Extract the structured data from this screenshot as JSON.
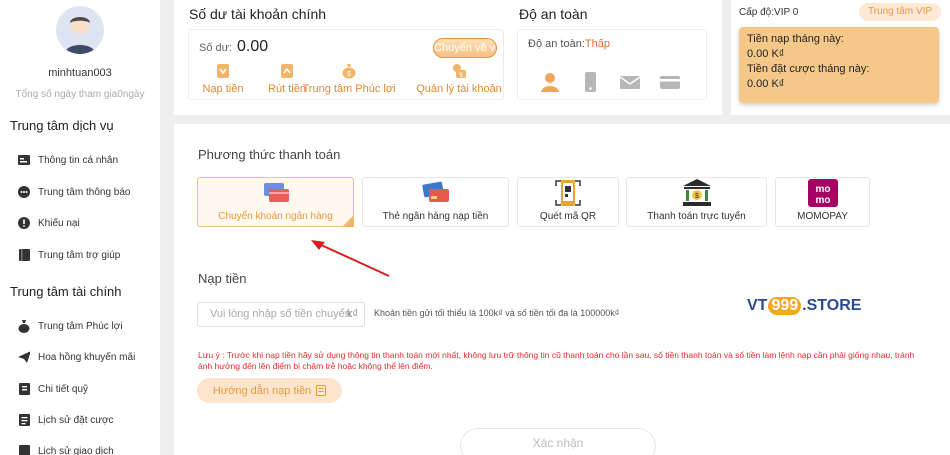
{
  "sidebar": {
    "username": "minhtuan003",
    "days_label": "Tổng số ngày tham gia0ngày",
    "service_title": "Trung tâm dịch vụ",
    "service_items": [
      {
        "label": "Thông tin cá nhân",
        "icon": "user-card-icon"
      },
      {
        "label": "Trung tâm thông báo",
        "icon": "message-icon"
      },
      {
        "label": "Khiếu nại",
        "icon": "complaint-icon"
      },
      {
        "label": "Trung tâm trợ giúp",
        "icon": "book-icon"
      }
    ],
    "finance_title": "Trung tâm tài chính",
    "finance_items": [
      {
        "label": "Trung tâm Phúc lợi",
        "icon": "money-bag-icon"
      },
      {
        "label": "Hoa hồng khuyến mãi",
        "icon": "paper-plane-icon"
      },
      {
        "label": "Chi tiết quỹ",
        "icon": "ledger-icon"
      },
      {
        "label": "Lịch sử đặt cược",
        "icon": "history-icon"
      },
      {
        "label": "Lịch sử giao dịch",
        "icon": "transaction-icon"
      }
    ]
  },
  "account": {
    "title": "Số dư tài khoản chính",
    "balance_label": "Số dư:",
    "balance_value": "0.00",
    "transfer_button": "Chuyển về ví",
    "actions": [
      {
        "label": "Nạp tiền",
        "icon": "deposit-icon"
      },
      {
        "label": "Rút tiền",
        "icon": "withdraw-icon"
      },
      {
        "label": "Trung tâm Phúc lợi",
        "icon": "welfare-bag-icon"
      },
      {
        "label": "Quản lý tài khoản",
        "icon": "account-manage-icon"
      }
    ]
  },
  "safety": {
    "title": "Độ an toàn",
    "level_label": "Độ an toàn:",
    "level_value": "Thấp",
    "icons": [
      "user-icon",
      "phone-icon",
      "mail-icon",
      "card-icon"
    ]
  },
  "vip": {
    "level": "Cấp độ:VIP 0",
    "center_button": "Trung tâm VIP",
    "deposit_label": "Tiền nạp tháng này:",
    "deposit_value": "0.00 K₫",
    "bet_label": "Tiền đặt cược tháng này:",
    "bet_value": "0.00 K₫"
  },
  "payment": {
    "title": "Phương thức thanh toán",
    "methods": [
      {
        "label": "Chuyển khoản ngân hàng",
        "icon": "bank-transfer-icon",
        "selected": true
      },
      {
        "label": "Thẻ ngân hàng nạp tiền",
        "icon": "bank-card-icon",
        "selected": false
      },
      {
        "label": "Quét mã QR",
        "icon": "qr-scan-icon",
        "selected": false
      },
      {
        "label": "Thanh toán trực tuyến",
        "icon": "online-bank-icon",
        "selected": false
      },
      {
        "label": "MOMOPAY",
        "icon": "momo-icon",
        "selected": false
      }
    ],
    "deposit_title": "Nạp tiền",
    "amount_placeholder": "Vui lòng nhập số tiền chuyển",
    "amount_unit": "k₫",
    "amount_hint": "Khoản tiền gửi tối thiểu là 100k₫ và số tiền tối đa là 100000k₫",
    "note": "Lưu ý : Trước khi nạp tiền hãy sử dụng thông tin thanh toán mới nhất, không lưu trữ thông tin cũ thanh toán cho lần sau, số tiền thanh toán và số tiền làm lệnh nạp cần phải giống nhau, tránh ảnh hưởng đến lên điểm bị chậm trễ hoặc không thể lên điểm.",
    "guide_button": "Hướng dẫn nạp tiền",
    "confirm_button": "Xác nhận"
  },
  "watermark": {
    "prefix": "VT",
    "badge": "999",
    "suffix": ".STORE"
  },
  "colors": {
    "accent": "#e59a3c",
    "warning": "#e02d2d",
    "vip_bg": "#f5c88a",
    "arrow": "#d81e1e"
  }
}
